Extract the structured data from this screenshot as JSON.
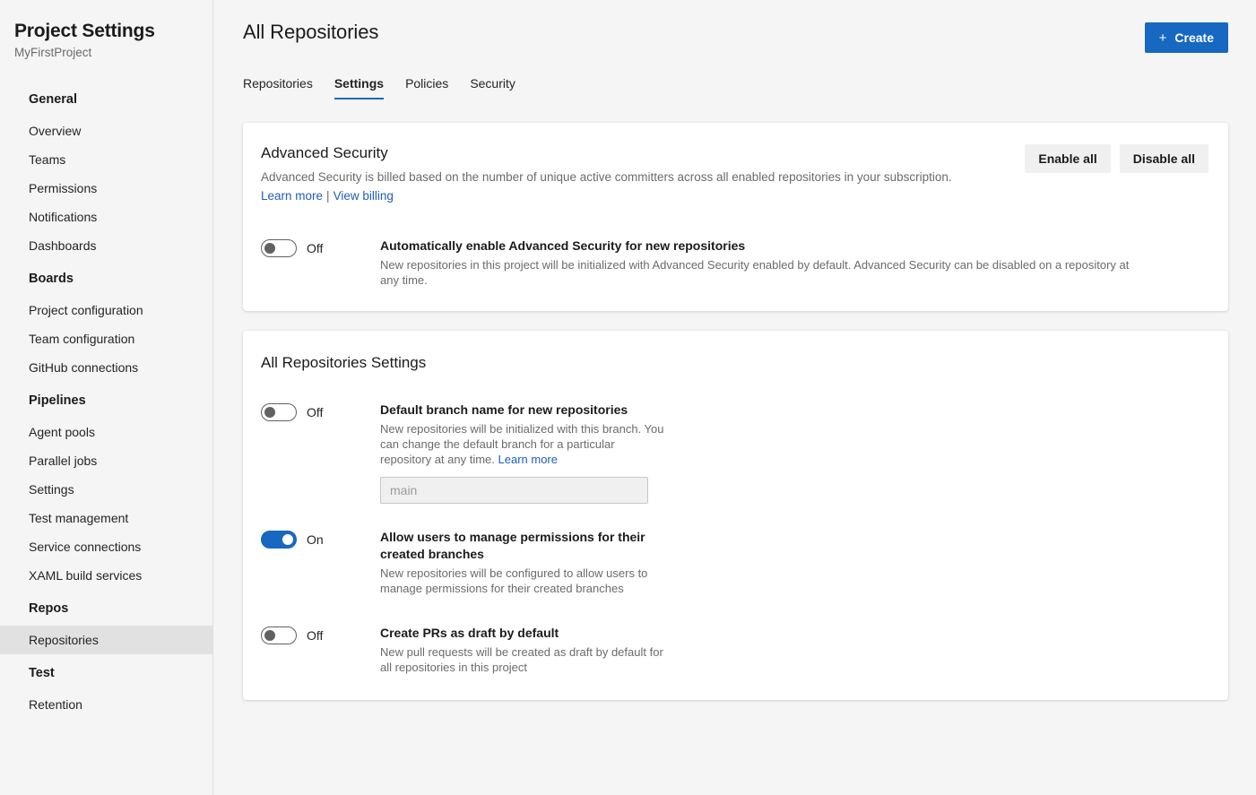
{
  "sidebar": {
    "title": "Project Settings",
    "project": "MyFirstProject",
    "groups": [
      {
        "label": "General",
        "items": [
          {
            "label": "Overview",
            "selected": false
          },
          {
            "label": "Teams",
            "selected": false
          },
          {
            "label": "Permissions",
            "selected": false
          },
          {
            "label": "Notifications",
            "selected": false
          },
          {
            "label": "Dashboards",
            "selected": false
          }
        ]
      },
      {
        "label": "Boards",
        "items": [
          {
            "label": "Project configuration",
            "selected": false
          },
          {
            "label": "Team configuration",
            "selected": false
          },
          {
            "label": "GitHub connections",
            "selected": false
          }
        ]
      },
      {
        "label": "Pipelines",
        "items": [
          {
            "label": "Agent pools",
            "selected": false
          },
          {
            "label": "Parallel jobs",
            "selected": false
          },
          {
            "label": "Settings",
            "selected": false
          },
          {
            "label": "Test management",
            "selected": false
          },
          {
            "label": "Service connections",
            "selected": false
          },
          {
            "label": "XAML build services",
            "selected": false
          }
        ]
      },
      {
        "label": "Repos",
        "items": [
          {
            "label": "Repositories",
            "selected": true
          }
        ]
      },
      {
        "label": "Test",
        "items": [
          {
            "label": "Retention",
            "selected": false
          }
        ]
      }
    ]
  },
  "header": {
    "title": "All Repositories",
    "create_button": {
      "label": "Create",
      "icon": "plus-icon"
    },
    "tabs": [
      {
        "label": "Repositories",
        "active": false
      },
      {
        "label": "Settings",
        "active": true
      },
      {
        "label": "Policies",
        "active": false
      },
      {
        "label": "Security",
        "active": false
      }
    ]
  },
  "advanced_security": {
    "title": "Advanced Security",
    "description": "Advanced Security is billed based on the number of unique active committers across all enabled repositories in your subscription.",
    "learn_more": "Learn more",
    "separator": "|",
    "view_billing": "View billing",
    "enable_all": "Enable all",
    "disable_all": "Disable all",
    "auto_enable": {
      "state": "Off",
      "title": "Automatically enable Advanced Security for new repositories",
      "description": "New repositories in this project will be initialized with Advanced Security enabled by default. Advanced Security can be disabled on a repository at any time."
    }
  },
  "all_repositories_settings": {
    "title": "All Repositories Settings",
    "default_branch": {
      "state": "Off",
      "title": "Default branch name for new repositories",
      "description": "New repositories will be initialized with this branch. You can change the default branch for a particular repository at any time.",
      "learn_more": "Learn more",
      "input_placeholder": "main",
      "input_value": ""
    },
    "manage_permissions": {
      "state": "On",
      "title": "Allow users to manage permissions for their created branches",
      "description": "New repositories will be configured to allow users to manage permissions for their created branches"
    },
    "create_prs_draft": {
      "state": "Off",
      "title": "Create PRs as draft by default",
      "description": "New pull requests will be created as draft by default for all repositories in this project"
    }
  },
  "colors": {
    "accent": "#1668c1",
    "link": "#1f5eb8",
    "page_bg": "#f5f5f5",
    "card_bg": "#ffffff",
    "selected_nav_bg": "#e1e1e1"
  }
}
